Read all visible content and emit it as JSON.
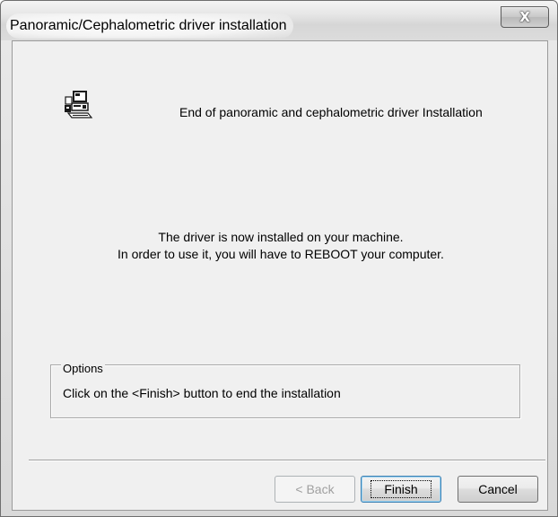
{
  "window": {
    "title": "Panoramic/Cephalometric driver installation",
    "close_symbol": "X",
    "icon": "computer-setup-icon"
  },
  "content": {
    "header": "End of panoramic and cephalometric driver Installation",
    "message_line1": "The driver is now installed on your machine.",
    "message_line2": "In order to use it, you will have to REBOOT your computer."
  },
  "options": {
    "legend": "Options",
    "text": "Click on the <Finish> button to end the installation"
  },
  "buttons": {
    "back_label": "< Back",
    "finish_label": "Finish",
    "cancel_label": "Cancel"
  },
  "colors": {
    "dialog_background": "#f0f0f0",
    "default_button_border": "#3c7fb1",
    "disabled_text": "#a0a0a0"
  }
}
